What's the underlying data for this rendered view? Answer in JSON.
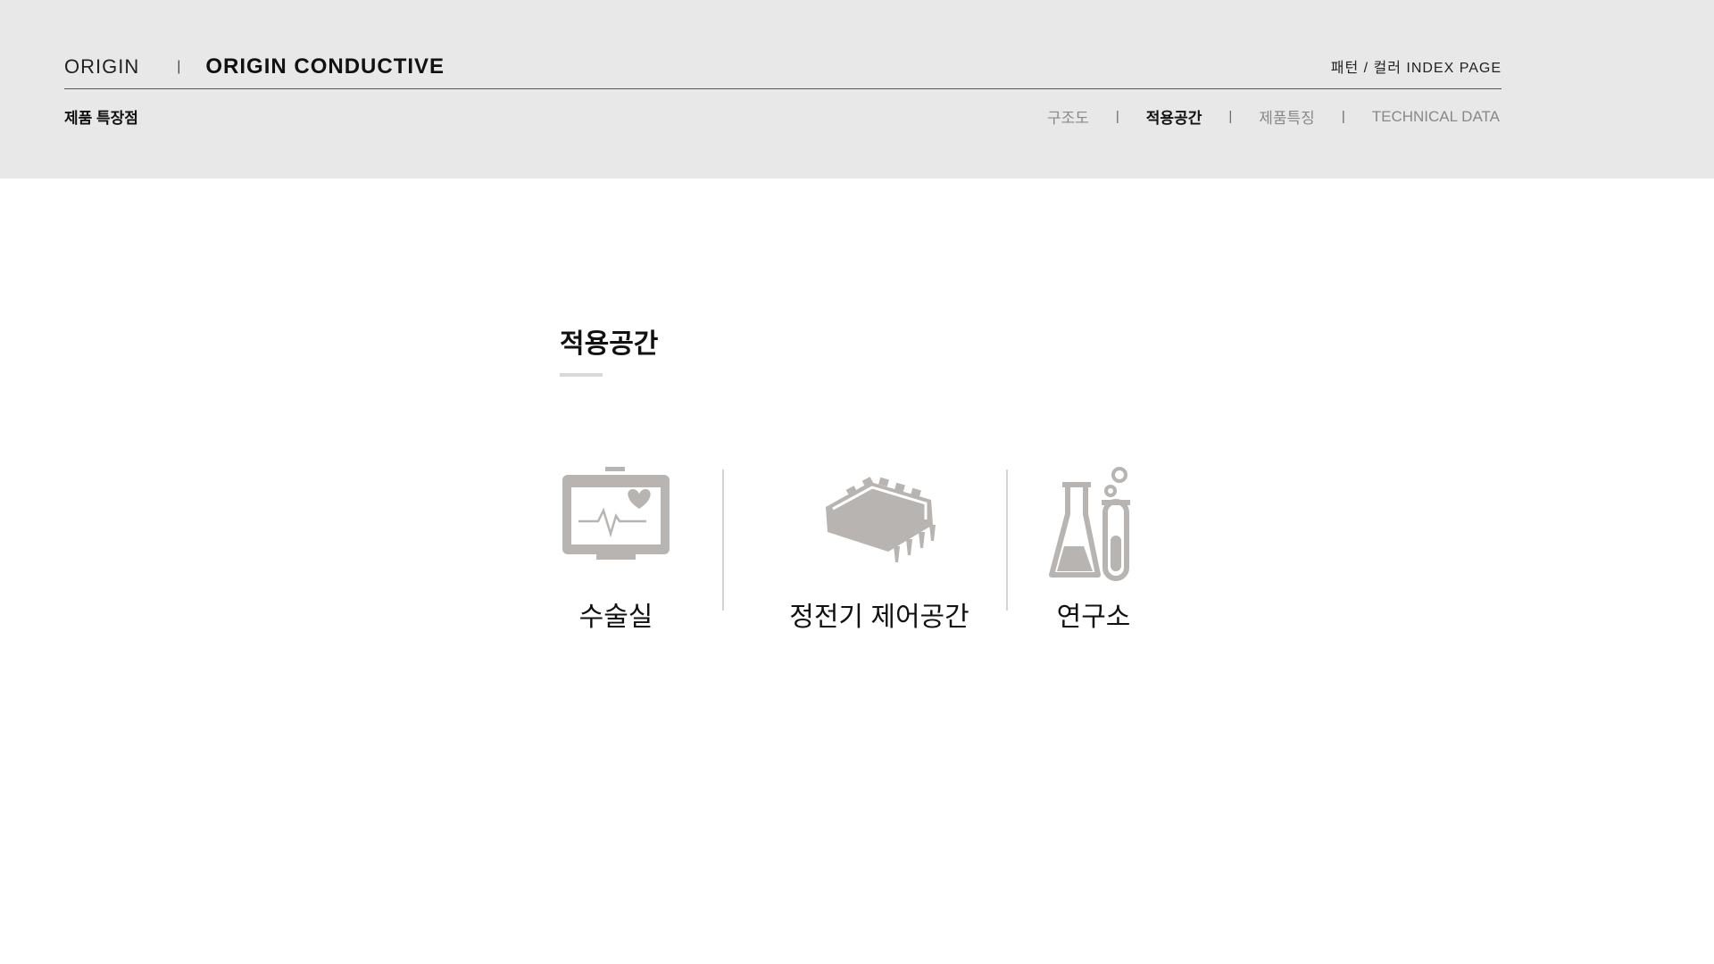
{
  "header": {
    "brand": "ORIGIN",
    "separator": "|",
    "product_name": "ORIGIN CONDUCTIVE",
    "index_link": "패턴 / 컬러 INDEX PAGE",
    "section_title": "제품 특장점",
    "tabs": [
      {
        "label": "구조도",
        "active": false
      },
      {
        "label": "적용공간",
        "active": true
      },
      {
        "label": "제품특징",
        "active": false
      },
      {
        "label": "TECHNICAL DATA",
        "active": false
      }
    ],
    "tab_divider": "|"
  },
  "content": {
    "title": "적용공간",
    "spaces": [
      {
        "label": "수술실",
        "icon": "heart-monitor-icon"
      },
      {
        "label": "정전기 제어공간",
        "icon": "microchip-icon"
      },
      {
        "label": "연구소",
        "icon": "lab-flask-icon"
      }
    ]
  },
  "colors": {
    "header_bg": "#e8e8e8",
    "icon_gray": "#b7b4b1",
    "divider_gray": "#d4d4d4"
  }
}
